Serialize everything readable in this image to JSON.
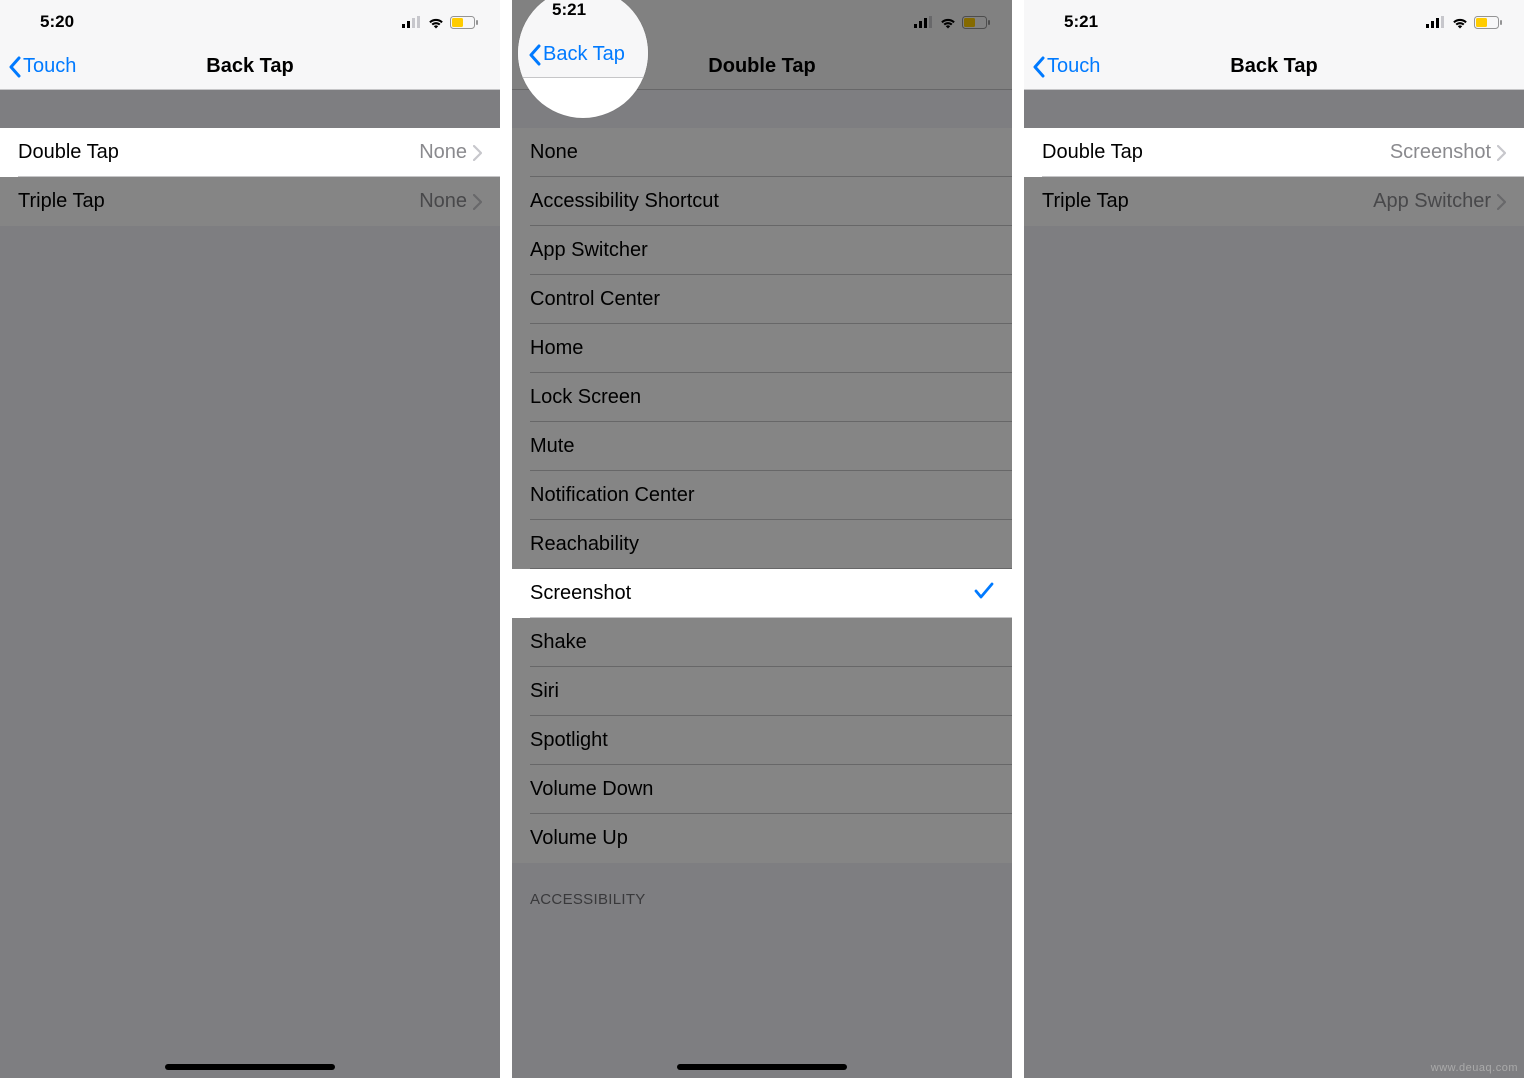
{
  "watermark": "www.deuaq.com",
  "phone1": {
    "time": "5:20",
    "back_label": "Touch",
    "title": "Back Tap",
    "rows": [
      {
        "label": "Double Tap",
        "value": "None",
        "highlighted": true
      },
      {
        "label": "Triple Tap",
        "value": "None",
        "highlighted": false
      }
    ]
  },
  "phone2": {
    "time": "5:21",
    "back_label": "Back Tap",
    "title": "Double Tap",
    "options": [
      "None",
      "Accessibility Shortcut",
      "App Switcher",
      "Control Center",
      "Home",
      "Lock Screen",
      "Mute",
      "Notification Center",
      "Reachability",
      "Screenshot",
      "Shake",
      "Siri",
      "Spotlight",
      "Volume Down",
      "Volume Up"
    ],
    "selected": "Screenshot",
    "section_header": "ACCESSIBILITY"
  },
  "phone3": {
    "time": "5:21",
    "back_label": "Touch",
    "title": "Back Tap",
    "rows": [
      {
        "label": "Double Tap",
        "value": "Screenshot",
        "highlighted": true
      },
      {
        "label": "Triple Tap",
        "value": "App Switcher",
        "highlighted": false
      }
    ]
  }
}
